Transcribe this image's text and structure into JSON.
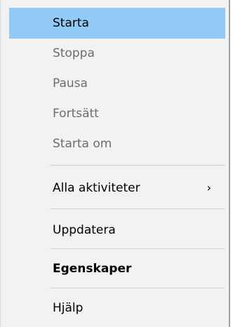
{
  "menu": {
    "items": [
      {
        "label": "Starta"
      },
      {
        "label": "Stoppa"
      },
      {
        "label": "Pausa"
      },
      {
        "label": "Fortsätt"
      },
      {
        "label": "Starta om"
      },
      {
        "label": "Alla aktiviteter",
        "submenu_icon": "›"
      },
      {
        "label": "Uppdatera"
      },
      {
        "label": "Egenskaper"
      },
      {
        "label": "Hjälp"
      }
    ]
  },
  "colors": {
    "highlight": "#91c9f7",
    "disabled_text": "#6d6d6d",
    "menu_background": "#f2f2f2"
  }
}
